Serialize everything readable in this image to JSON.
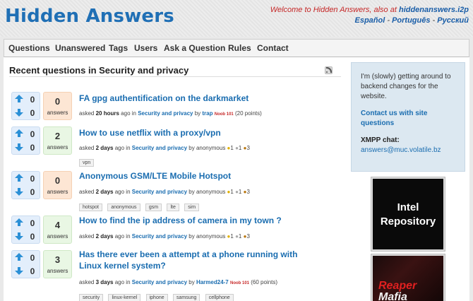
{
  "site": {
    "logo": "Hidden Answers",
    "welcome_prefix": "Welcome to Hidden Answers, also at",
    "welcome_domain": "hiddenanswers.i2p",
    "languages": [
      "Español",
      "Português",
      "Русский"
    ],
    "rss_icon": "rss-icon"
  },
  "nav": [
    "Questions",
    "Unanswered",
    "Tags",
    "Users",
    "Ask a Question",
    "Rules",
    "Contact"
  ],
  "page": {
    "title": "Recent questions in Security and privacy"
  },
  "questions": [
    {
      "up": "0",
      "down": "0",
      "answers": "0",
      "answers_label": "answers",
      "title": "FA gpg authentification on the darkmarket",
      "asked": "asked",
      "when": "20 hours",
      "ago_in": "ago in",
      "category": "Security and privacy",
      "by": "by",
      "user": "trap",
      "badge_text": "Noob 101",
      "points": "(20 points)",
      "tags": []
    },
    {
      "up": "0",
      "down": "0",
      "answers": "2",
      "answers_label": "answers",
      "title": "How to use netflix with a proxy/vpn",
      "asked": "asked",
      "when": "2 days",
      "ago_in": "ago in",
      "category": "Security and privacy",
      "by": "by",
      "user": "anonymous",
      "badges": [
        "1",
        "1",
        "3"
      ],
      "tags": [
        "vpn"
      ]
    },
    {
      "up": "0",
      "down": "0",
      "answers": "0",
      "answers_label": "answers",
      "title": "Anonymous GSM/LTE Mobile Hotspot",
      "asked": "asked",
      "when": "2 days",
      "ago_in": "ago in",
      "category": "Security and privacy",
      "by": "by",
      "user": "anonymous",
      "badges": [
        "1",
        "1",
        "3"
      ],
      "tags": [
        "hotspot",
        "anonymous",
        "gsm",
        "lte",
        "sim"
      ]
    },
    {
      "up": "0",
      "down": "0",
      "answers": "4",
      "answers_label": "answers",
      "title": "How to find the ip address of camera in my town ?",
      "asked": "asked",
      "when": "2 days",
      "ago_in": "ago in",
      "category": "Security and privacy",
      "by": "by",
      "user": "anonymous",
      "badges": [
        "1",
        "1",
        "3"
      ],
      "tags": []
    },
    {
      "up": "0",
      "down": "0",
      "answers": "3",
      "answers_label": "answers",
      "title": "Has there ever been a attempt at a phone running with Linux kernel system?",
      "asked": "asked",
      "when": "3 days",
      "ago_in": "ago in",
      "category": "Security and privacy",
      "by": "by",
      "user": "Harmed24-7",
      "badge_text": "Noob 101",
      "points": "(60 points)",
      "tags": [
        "security",
        "linux-kernel",
        "iphone",
        "samsung",
        "cellphone"
      ]
    }
  ],
  "sidebar": {
    "intro": "I'm (slowly) getting around to backend changes for the website.",
    "contact_link": "Contact us with site questions",
    "xmpp_label": "XMPP chat:",
    "xmpp_address": "answers@muc.volatile.bz"
  },
  "ads": {
    "ad1_line1": "Intel",
    "ad1_line2": "Repository",
    "ad2_line1": "Reaper",
    "ad2_line2": "Mafia"
  },
  "colors": {
    "brand_blue": "#1f6fb5",
    "welcome_red": "#c62828",
    "zero_answers_bg": "#fde6d4",
    "has_answers_bg": "#e9f7e4",
    "vote_bg": "#e3eefb",
    "sidebar_bg": "#dce8f1"
  }
}
